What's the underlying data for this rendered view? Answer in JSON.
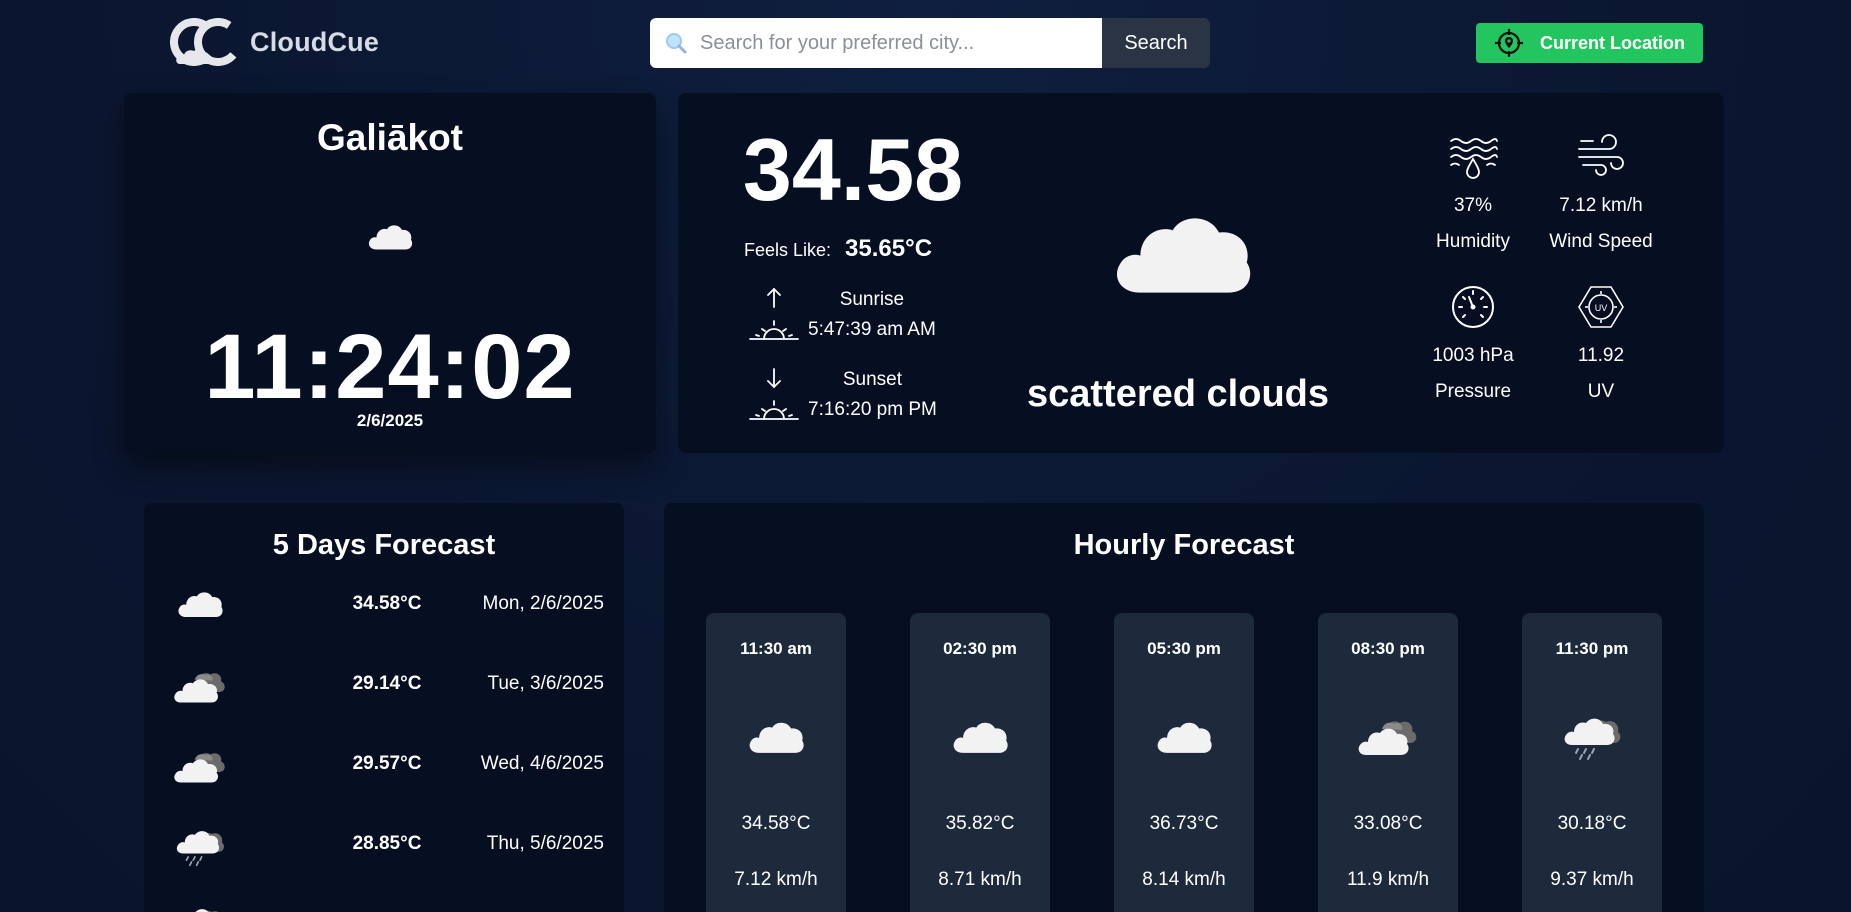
{
  "brand": {
    "name": "CloudCue"
  },
  "search": {
    "placeholder": "Search for your preferred city...",
    "button_label": "Search"
  },
  "location_button": {
    "label": "Current Location"
  },
  "city": {
    "name": "Galiākot",
    "time": "11:24:02",
    "date": "2/6/2025",
    "icon": "cloud-icon"
  },
  "current": {
    "temperature": "34.58",
    "feels_like_label": "Feels Like:",
    "feels_like_value": "35.65°C",
    "sunrise_label": "Sunrise",
    "sunrise_time": "5:47:39 am AM",
    "sunset_label": "Sunset",
    "sunset_time": "7:16:20 pm PM",
    "condition": "scattered clouds",
    "condition_icon": "cloud-icon",
    "humidity_value": "37%",
    "humidity_label": "Humidity",
    "wind_value": "7.12 km/h",
    "wind_label": "Wind Speed",
    "pressure_value": "1003 hPa",
    "pressure_label": "Pressure",
    "uv_value": "11.92",
    "uv_label": "UV"
  },
  "five_day": {
    "title": "5 Days Forecast",
    "items": [
      {
        "icon": "cloud-icon",
        "temp": "34.58°C",
        "date": "Mon, 2/6/2025"
      },
      {
        "icon": "broken-clouds-icon",
        "temp": "29.14°C",
        "date": "Tue, 3/6/2025"
      },
      {
        "icon": "broken-clouds-icon",
        "temp": "29.57°C",
        "date": "Wed, 4/6/2025"
      },
      {
        "icon": "rain-cloud-icon",
        "temp": "28.85°C",
        "date": "Thu, 5/6/2025"
      }
    ]
  },
  "hourly": {
    "title": "Hourly Forecast",
    "items": [
      {
        "time": "11:30 am",
        "icon": "cloud-icon",
        "temp": "34.58°C",
        "wind": "7.12 km/h"
      },
      {
        "time": "02:30 pm",
        "icon": "cloud-icon",
        "temp": "35.82°C",
        "wind": "8.71 km/h"
      },
      {
        "time": "05:30 pm",
        "icon": "cloud-icon",
        "temp": "36.73°C",
        "wind": "8.14 km/h"
      },
      {
        "time": "08:30 pm",
        "icon": "broken-clouds-icon",
        "temp": "33.08°C",
        "wind": "11.9 km/h"
      },
      {
        "time": "11:30 pm",
        "icon": "rain-cloud-icon",
        "temp": "30.18°C",
        "wind": "9.37 km/h"
      }
    ]
  },
  "colors": {
    "background": "#0b1731",
    "card": "#060e22",
    "hour_card": "#1d2a3b",
    "accent": "#22c55e",
    "search_button": "#2b3444"
  }
}
